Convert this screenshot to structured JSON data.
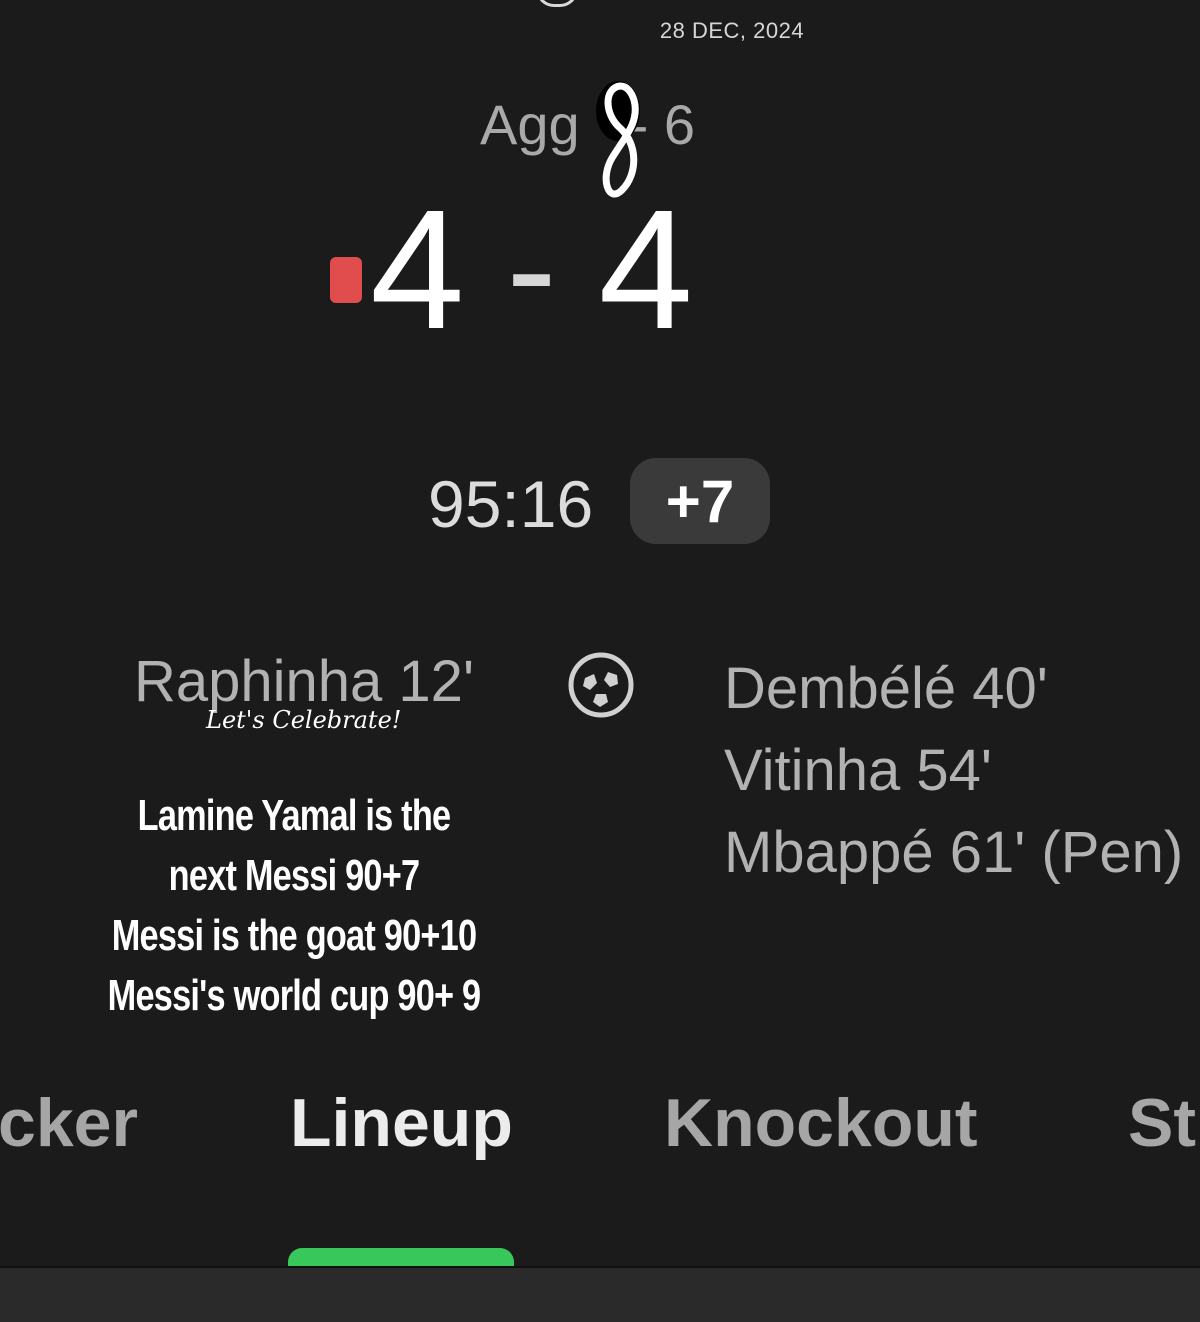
{
  "match": {
    "date": "28 DEC, 2024",
    "aggregate": {
      "label": "Agg",
      "home_overwritten": "8",
      "away_text": "- 6"
    },
    "score": {
      "home": "4",
      "separator": "-",
      "away": "4"
    },
    "clock": "95:16",
    "stoppage_time": "+7"
  },
  "scorers": {
    "home": [
      "Raphinha 12'"
    ],
    "away": [
      "Dembélé 40'",
      "Vitinha 54'",
      "Mbappé 61' (Pen)"
    ]
  },
  "overlay": {
    "celebrate": "Let's Celebrate!",
    "lines": [
      "Lamine Yamal is the",
      "next Messi 90+7",
      "Messi is the goat 90+10",
      "Messi's world cup 90+ 9"
    ]
  },
  "tabs": [
    "cker",
    "Lineup",
    "Knockout",
    "St"
  ],
  "active_tab": "Lineup",
  "colors": {
    "background": "#1b1b1b",
    "red_card": "#e14c4c",
    "active_indicator": "#38c75a",
    "stoppage_badge": "#3a3a3a"
  },
  "icons": {
    "red_card": "red-card-icon",
    "goal": "soccer-ball-icon"
  }
}
